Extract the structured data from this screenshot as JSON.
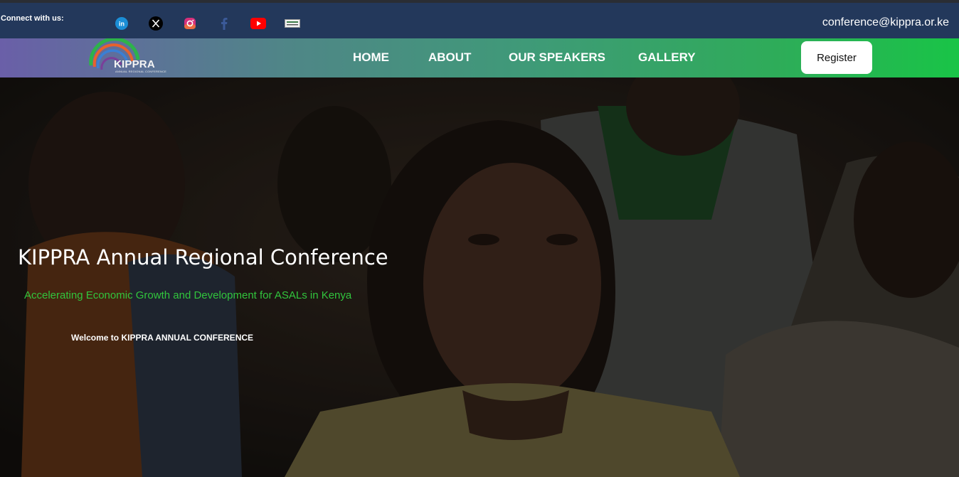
{
  "topbar": {
    "connect_label": "Connect with us:",
    "email": "conference@kippra.or.ke",
    "social_icons": [
      "linkedin-icon",
      "x-icon",
      "instagram-icon",
      "facebook-icon",
      "youtube-icon",
      "kippra-badge-icon"
    ]
  },
  "logo": {
    "name": "KIPPRA",
    "subtitle": "ANNUAL REGIONAL CONFERENCE"
  },
  "nav": {
    "items": [
      {
        "label": "HOME"
      },
      {
        "label": "ABOUT"
      },
      {
        "label": "OUR SPEAKERS"
      },
      {
        "label": "GALLERY"
      }
    ],
    "register_label": "Register"
  },
  "hero": {
    "title": "KIPPRA Annual Regional Conference",
    "tagline": "Accelerating Economic Growth and Development for ASALs in Kenya",
    "welcome": "Welcome to KIPPRA ANNUAL CONFERENCE"
  },
  "colors": {
    "topbar_bg": "#23385b",
    "nav_gradient_start": "#6a5fa8",
    "nav_gradient_end": "#19c447",
    "tagline": "#31c53d",
    "register_bg": "#ffffff"
  }
}
